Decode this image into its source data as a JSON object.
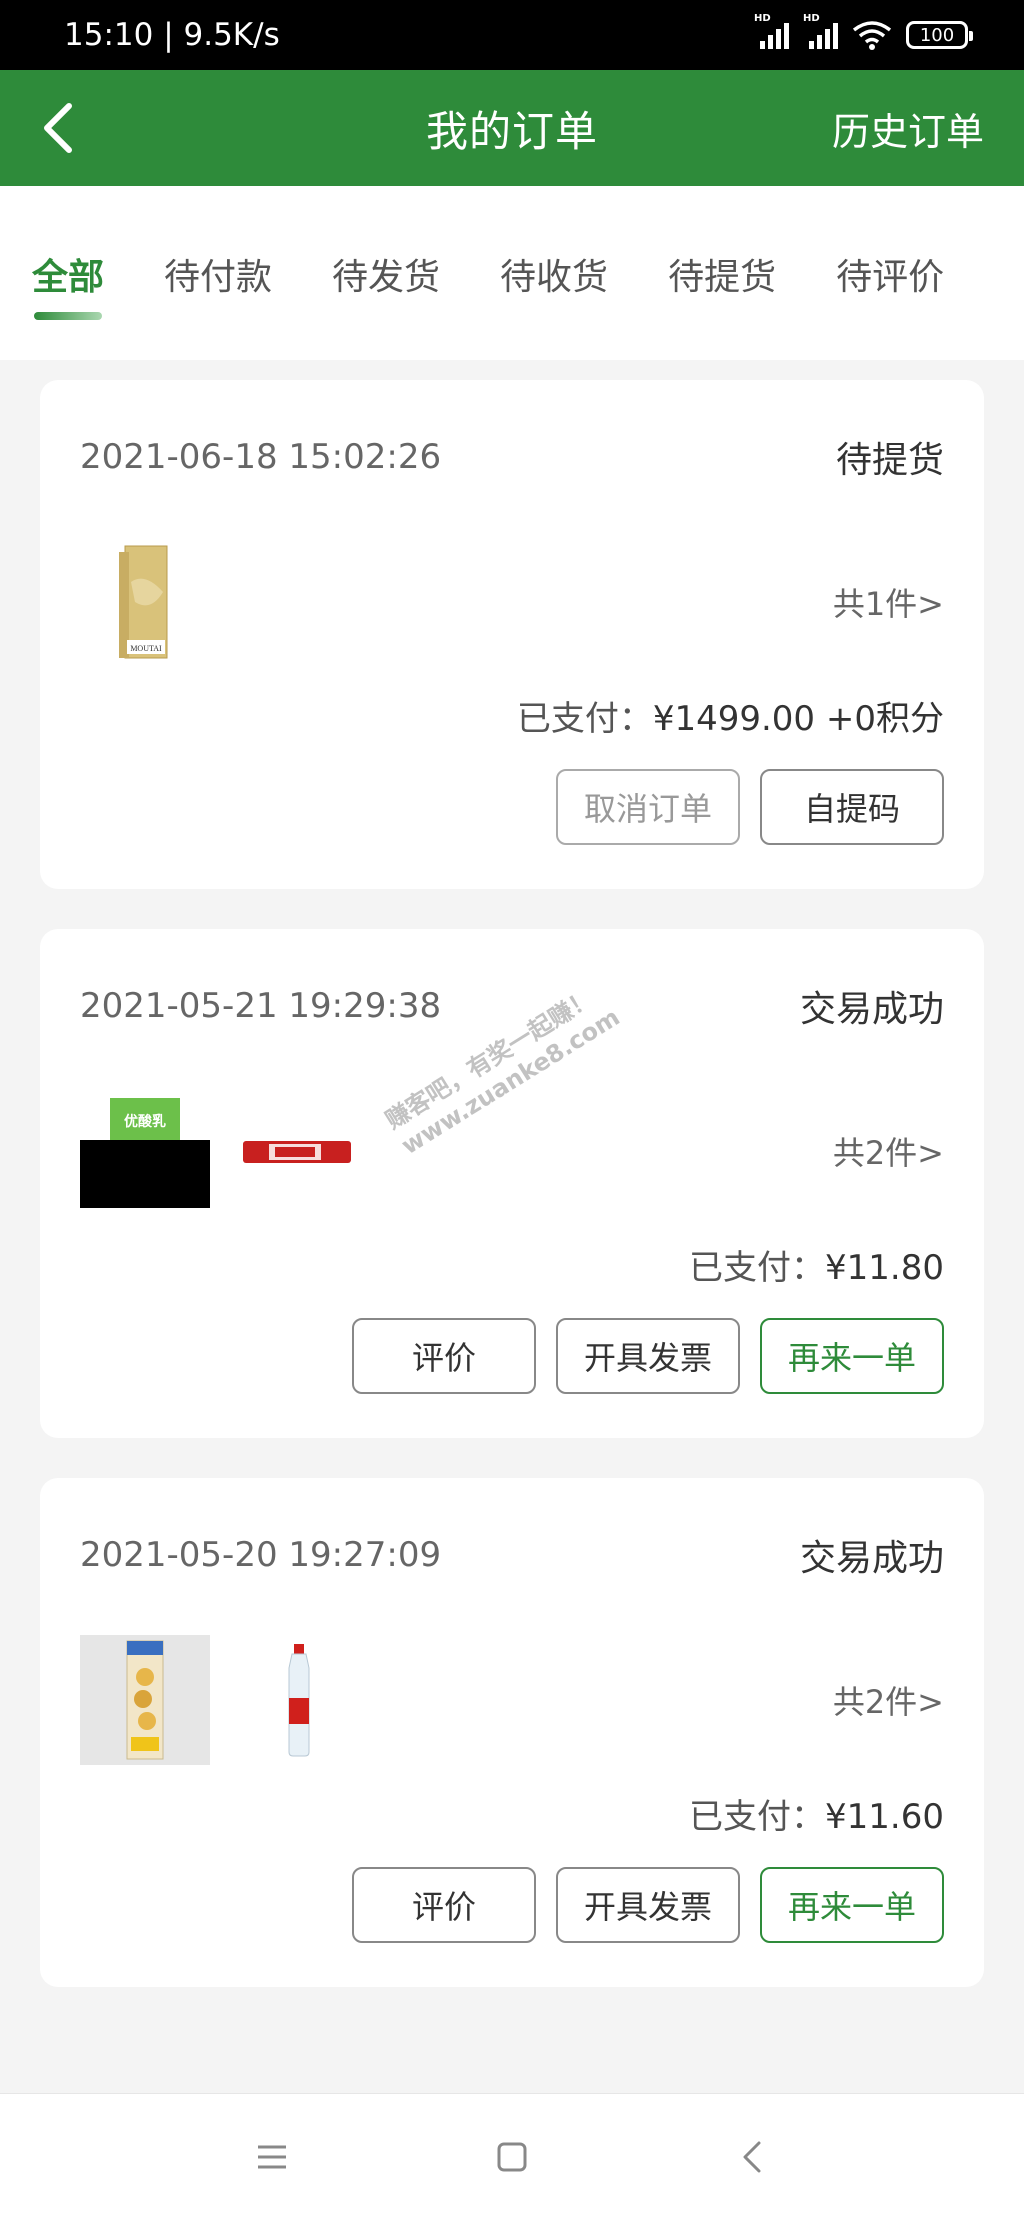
{
  "status_bar": {
    "time": "15:10",
    "speed": "9.5K/s",
    "hd1": "HD",
    "hd2": "HD",
    "battery": "100"
  },
  "header": {
    "title": "我的订单",
    "right_link": "历史订单"
  },
  "tabs": [
    {
      "label": "全部",
      "active": true
    },
    {
      "label": "待付款",
      "active": false
    },
    {
      "label": "待发货",
      "active": false
    },
    {
      "label": "待收货",
      "active": false
    },
    {
      "label": "待提货",
      "active": false
    },
    {
      "label": "待评价",
      "active": false
    }
  ],
  "orders": [
    {
      "date": "2021-06-18 15:02:26",
      "status": "待提货",
      "count": "共1件>",
      "paid_label": "已支付：",
      "paid_amount": "¥1499.00 +0积分",
      "buttons": [
        "取消订单",
        "自提码"
      ],
      "product_label": "MOUTAI"
    },
    {
      "date": "2021-05-21 19:29:38",
      "status": "交易成功",
      "count": "共2件>",
      "paid_label": "已支付：",
      "paid_amount": "¥11.80",
      "buttons": [
        "评价",
        "开具发票",
        "再来一单"
      ],
      "product_label": "优酸乳"
    },
    {
      "date": "2021-05-20 19:27:09",
      "status": "交易成功",
      "count": "共2件>",
      "paid_label": "已支付：",
      "paid_amount": "¥11.60",
      "buttons": [
        "评价",
        "开具发票",
        "再来一单"
      ]
    }
  ],
  "watermark": {
    "line1": "赚客吧，有奖一起赚！",
    "line2": "www.zuanke8.com"
  },
  "colors": {
    "brand_green": "#2e8b3a",
    "background": "#f4f4f4"
  },
  "icons": {
    "back": "chevron-left-icon",
    "menu": "menu-icon",
    "home": "home-square-icon",
    "sys_back": "back-icon"
  }
}
